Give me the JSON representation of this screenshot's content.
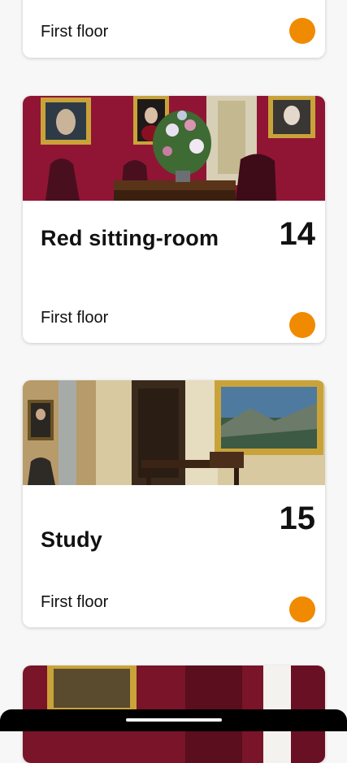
{
  "theme": {
    "accent": "#f08a00",
    "background": "#f7f7f7",
    "card": "#ffffff"
  },
  "rooms": [
    {
      "floor": "First floor"
    },
    {
      "number": "14",
      "title": "Red sitting-room",
      "floor": "First floor",
      "image": "red-sitting-room-photo"
    },
    {
      "number": "15",
      "title": "Study",
      "floor": "First floor",
      "image": "study-photo"
    },
    {
      "image": "next-room-photo"
    }
  ],
  "system": {
    "home_indicator": "home-indicator-icon"
  }
}
